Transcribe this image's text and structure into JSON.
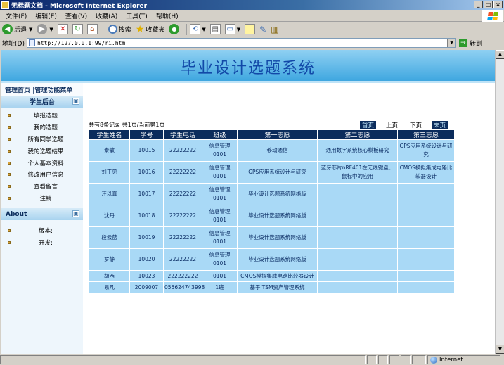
{
  "window": {
    "title": "无标题文档 - Microsoft Internet Explorer"
  },
  "menubar": {
    "items": [
      "文件(F)",
      "编辑(E)",
      "查看(V)",
      "收藏(A)",
      "工具(T)",
      "帮助(H)"
    ]
  },
  "toolbar": {
    "back_label": "后退",
    "search_label": "搜索",
    "favorites_label": "收藏夹"
  },
  "addressbar": {
    "label": "地址(D)",
    "url": "http://127.0.0.1:99/ri.htm",
    "go_label": "转到"
  },
  "banner": {
    "title": "毕业设计选题系统"
  },
  "sidebar": {
    "top_links": "管理首页 |管理功能菜单",
    "student_section": "学生后台",
    "items": [
      "填报选题",
      "我的选题",
      "所有同学选题",
      "我的选题结果",
      "个人基本资料",
      "修改用户信息",
      "查看留言",
      "注销"
    ],
    "about_title": "About",
    "about_items": [
      "版本:",
      "开发:"
    ]
  },
  "content": {
    "record_info": "共有8条记录    共1页/当前第1页",
    "pager": {
      "first": "首页",
      "prev": "上页",
      "next": "下页",
      "last": "末页"
    },
    "columns": [
      "学生姓名",
      "学号",
      "学生电话",
      "班级",
      "第一志愿",
      "第二志愿",
      "第三志愿"
    ],
    "rows": [
      [
        "秦敏",
        "10015",
        "22222222",
        "信息管理 0101",
        "移动通信",
        "通用数字系统核心模板研究",
        "GPS应用系统设计与研究"
      ],
      [
        "刘正见",
        "10016",
        "22222222",
        "信息管理 0101",
        "GPS应用系统设计与研究",
        "蓝牙芯片nRF401在无线键盘、鼠标中的应用",
        "CMOS模拟集成电路比较器设计"
      ],
      [
        "汪以真",
        "10017",
        "22222222",
        "信息管理 0101",
        "毕业设计选题系统网络版",
        "",
        ""
      ],
      [
        "沈丹",
        "10018",
        "22222222",
        "信息管理 0101",
        "毕业设计选题系统网络版",
        "",
        ""
      ],
      [
        "段云蓝",
        "10019",
        "22222222",
        "信息管理 0101",
        "毕业设计选题系统网络版",
        "",
        ""
      ],
      [
        "罗静",
        "10020",
        "22222222",
        "信息管理 0101",
        "毕业设计选题系统网络版",
        "",
        ""
      ],
      [
        "胡西",
        "10023",
        "222222222",
        "0101",
        "CMOS模拟集成电路比较器设计",
        "",
        ""
      ],
      [
        "易凡",
        "2009007",
        "055624743998",
        "1班",
        "基于ITSM资产管理系统",
        "",
        ""
      ]
    ]
  },
  "statusbar": {
    "zone": "Internet"
  },
  "colors": {
    "banner_text": "#1249a8",
    "table_header_bg": "#0b2c5c",
    "table_cell_bg": "#a9d9f6"
  }
}
